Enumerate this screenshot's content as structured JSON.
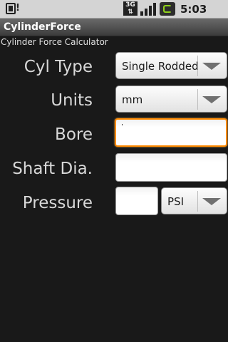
{
  "status_bar": {
    "notification_icon": "warning-sd-icon",
    "network_type": "3G",
    "signal_icon": "signal-bars-icon",
    "battery_icon": "battery-charging-icon",
    "time": "5:03 PM"
  },
  "app": {
    "title": "CylinderForce",
    "subtitle": "Cylinder Force Calculator"
  },
  "form": {
    "cyl_type": {
      "label": "Cyl Type",
      "selected": "Single Rodded"
    },
    "units": {
      "label": "Units",
      "selected": "mm"
    },
    "bore": {
      "label": "Bore",
      "value": ""
    },
    "shaft": {
      "label": "Shaft Dia.",
      "value": ""
    },
    "pressure": {
      "label": "Pressure",
      "value": "",
      "unit_selected": "PSI"
    }
  },
  "colors": {
    "background": "#191919",
    "focus_border": "#ff8a00",
    "status_bar": "#d4d4d4"
  }
}
